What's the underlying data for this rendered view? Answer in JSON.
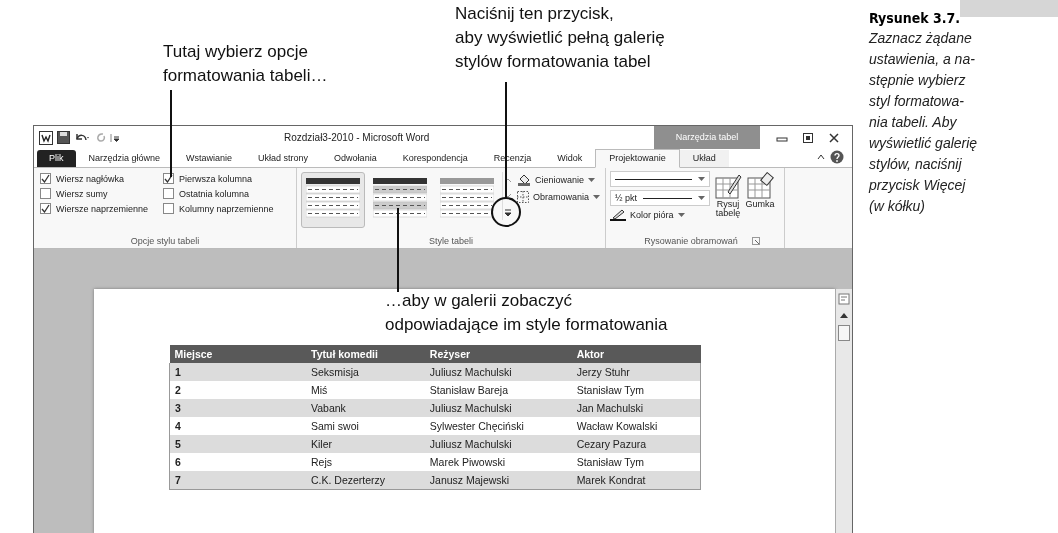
{
  "callouts": [
    {
      "kind": "options",
      "lines": [
        "Tutaj wybierz opcje",
        "formatowania tabeli…"
      ]
    },
    {
      "kind": "more",
      "lines": [
        "Naciśnij ten przycisk,",
        "aby wyświetlić pełną galerię",
        "stylów formatowania tabel"
      ]
    },
    {
      "kind": "gallery",
      "lines": [
        "…aby w galerii zobaczyć",
        "odpowiadające im style formatowania"
      ]
    }
  ],
  "window": {
    "title": "Rozdział3-2010 - Microsoft Word",
    "context_tab": "Narzędzia tabel"
  },
  "tabs": [
    {
      "label": "Plik",
      "kind": "file",
      "selected": false
    },
    {
      "label": "Narzędzia główne",
      "kind": "tab",
      "selected": false
    },
    {
      "label": "Wstawianie",
      "kind": "tab",
      "selected": false
    },
    {
      "label": "Układ strony",
      "kind": "tab",
      "selected": false
    },
    {
      "label": "Odwołania",
      "kind": "tab",
      "selected": false
    },
    {
      "label": "Korespondencja",
      "kind": "tab",
      "selected": false
    },
    {
      "label": "Recenzja",
      "kind": "tab",
      "selected": false
    },
    {
      "label": "Widok",
      "kind": "tab",
      "selected": false
    },
    {
      "label": "Projektowanie",
      "kind": "context",
      "selected": true
    },
    {
      "label": "Układ",
      "kind": "context",
      "selected": false
    }
  ],
  "ribbon": {
    "style_options": {
      "label": "Opcje stylu tabeli",
      "options": [
        {
          "label": "Wiersz nagłówka",
          "checked": true
        },
        {
          "label": "Pierwsza kolumna",
          "checked": true
        },
        {
          "label": "Wiersz sumy",
          "checked": false
        },
        {
          "label": "Ostatnia kolumna",
          "checked": false
        },
        {
          "label": "Wiersze naprzemienne",
          "checked": true
        },
        {
          "label": "Kolumny naprzemienne",
          "checked": false
        }
      ]
    },
    "table_styles": {
      "label": "Style tabeli",
      "gallery": [
        {
          "selected": true
        },
        {
          "selected": false
        },
        {
          "selected": false
        }
      ],
      "buttons": [
        {
          "label": "Cieniowanie"
        },
        {
          "label": "Obramowania"
        }
      ]
    },
    "borders": {
      "label": "Rysowanie obramowań",
      "weight": "½ pkt",
      "pen_color": "Kolor pióra",
      "buttons": [
        {
          "label": "Rysuj tabelę",
          "kind": "draw"
        },
        {
          "label": "Gumka",
          "kind": "eraser"
        }
      ]
    }
  },
  "table": {
    "columns": [
      "Miejsce",
      "Tytuł komedii",
      "Reżyser",
      "Aktor"
    ],
    "rows": [
      [
        "1",
        "Seksmisja",
        "Juliusz Machulski",
        "Jerzy Stuhr"
      ],
      [
        "2",
        "Miś",
        "Stanisław Bareja",
        "Stanisław Tym"
      ],
      [
        "3",
        "Vabank",
        "Juliusz Machulski",
        "Jan Machulski"
      ],
      [
        "4",
        "Sami swoi",
        "Sylwester Chęciński",
        "Wacław Kowalski"
      ],
      [
        "5",
        "Kiler",
        "Juliusz Machulski",
        "Cezary Pazura"
      ],
      [
        "6",
        "Rejs",
        "Marek Piwowski",
        "Stanisław Tym"
      ],
      [
        "7",
        "C.K. Dezerterzy",
        "Janusz Majewski",
        "Marek Kondrat"
      ]
    ]
  },
  "caption": {
    "title": "Rysunek 3.7.",
    "lines": [
      "Zaznacz żądane",
      "ustawienia, a na-",
      "stępnie wybierz",
      "styl formatowa-",
      "nia tabeli. Aby",
      "wyświetlić galerię",
      "stylów, naciśnij",
      "przycisk Więcej",
      "(w kółku)"
    ]
  }
}
